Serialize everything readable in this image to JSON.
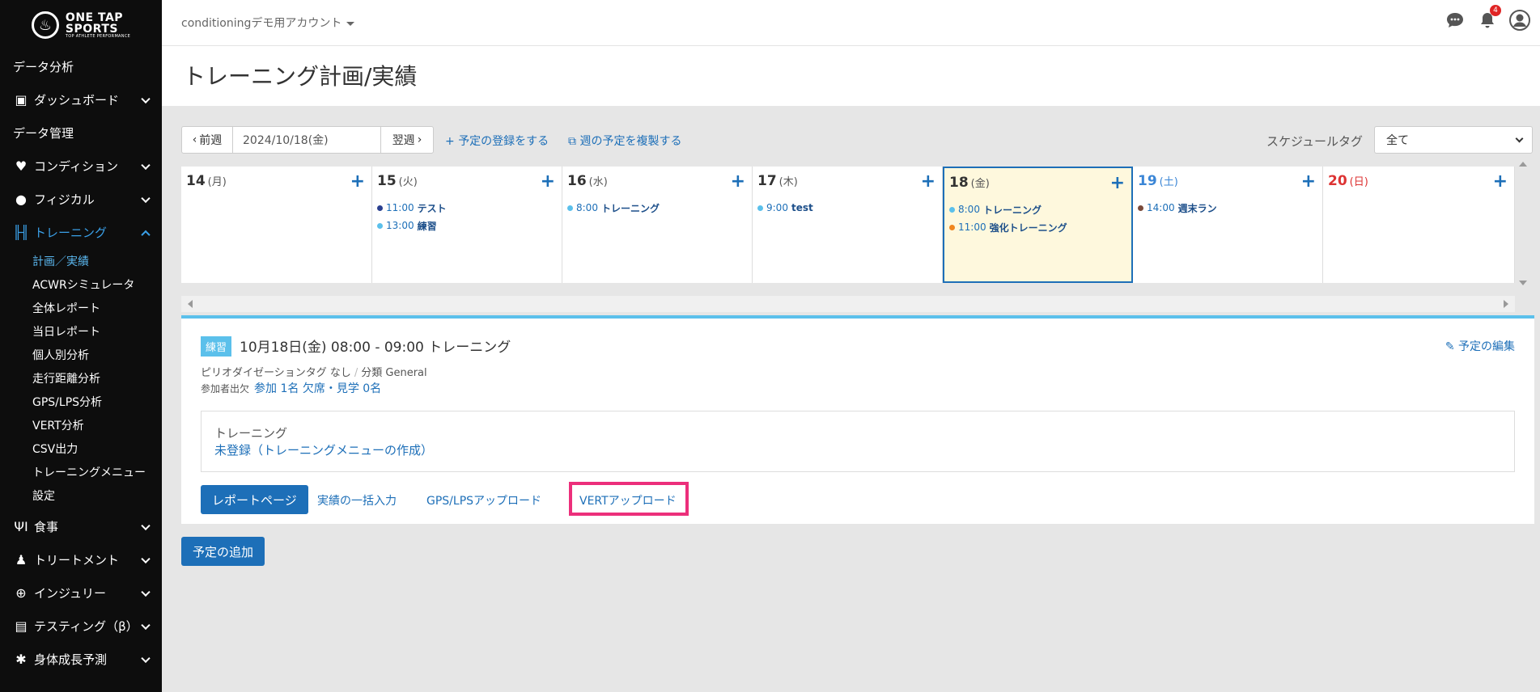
{
  "brand": {
    "line1": "ONE TAP",
    "line2": "SPORTS",
    "tagline": "TOP ATHLETE PERFORMANCE"
  },
  "account": {
    "name": "conditioningデモ用アカウント"
  },
  "notifications": {
    "count": "4"
  },
  "sidebar": {
    "data_analysis": "データ分析",
    "dashboard": "ダッシュボード",
    "data_management": "データ管理",
    "condition": "コンディション",
    "physical": "フィジカル",
    "training": "トレーニング",
    "training_sub": [
      "計画／実績",
      "ACWRシミュレータ",
      "全体レポート",
      "当日レポート",
      "個人別分析",
      "走行距離分析",
      "GPS/LPS分析",
      "VERT分析",
      "CSV出力",
      "トレーニングメニュー",
      "設定"
    ],
    "meal": "食事",
    "treatment": "トリートメント",
    "injury": "インジュリー",
    "testing": "テスティング（β）",
    "growth": "身体成長予測"
  },
  "page": {
    "title": "トレーニング計画/実績"
  },
  "toolbar": {
    "prev": "前週",
    "date": "2024/10/18(金)",
    "next": "翌週",
    "register": "予定の登録をする",
    "copy_week": "週の予定を複製する",
    "schedule_tag_label": "スケジュールタグ",
    "schedule_tag_value": "全て"
  },
  "calendar": {
    "days": [
      {
        "num": "14",
        "wd": "(月)",
        "events": []
      },
      {
        "num": "15",
        "wd": "(火)",
        "events": [
          {
            "time": "11:00",
            "name": "テスト",
            "color": "#2a3f8f"
          },
          {
            "time": "13:00",
            "name": "練習",
            "color": "#5bc0eb"
          }
        ]
      },
      {
        "num": "16",
        "wd": "(水)",
        "events": [
          {
            "time": "8:00",
            "name": "トレーニング",
            "color": "#5bc0eb"
          }
        ]
      },
      {
        "num": "17",
        "wd": "(木)",
        "events": [
          {
            "time": "9:00",
            "name": "test",
            "color": "#5bc0eb"
          }
        ]
      },
      {
        "num": "18",
        "wd": "(金)",
        "events": [
          {
            "time": "8:00",
            "name": "トレーニング",
            "color": "#5bc0eb"
          },
          {
            "time": "11:00",
            "name": "強化トレーニング",
            "color": "#f0861e"
          }
        ]
      },
      {
        "num": "19",
        "wd": "(土)",
        "events": [
          {
            "time": "14:00",
            "name": "週末ラン",
            "color": "#7a4a3a"
          }
        ]
      },
      {
        "num": "20",
        "wd": "(日)",
        "events": []
      }
    ]
  },
  "detail": {
    "tag": "練習",
    "title": "10月18日(金) 08:00 - 09:00 トレーニング",
    "edit": "予定の編集",
    "periodization": "ピリオダイゼーションタグ なし",
    "sep": "/",
    "category": "分類 General",
    "attendance_label": "参加者出欠",
    "attendance_value": "参加 1名 欠席・見学 0名",
    "menu_label": "トレーニング",
    "menu_link": "未登録（トレーニングメニューの作成）",
    "report_button": "レポートページ",
    "bulk_input": "実績の一括入力",
    "gps_upload": "GPS/LPSアップロード",
    "vert_upload": "VERTアップロード"
  },
  "add_schedule": "予定の追加"
}
